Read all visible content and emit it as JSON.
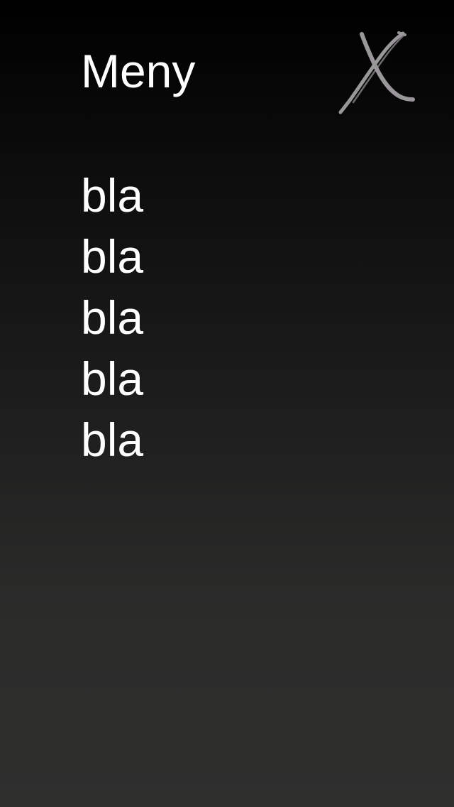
{
  "menu": {
    "title": "Meny",
    "close_icon": "close-x-icon",
    "close_icon_color": "#9a979a",
    "items": [
      {
        "label": "bla"
      },
      {
        "label": "bla"
      },
      {
        "label": "bla"
      },
      {
        "label": "bla"
      },
      {
        "label": "bla"
      }
    ]
  },
  "colors": {
    "background_top": "#000000",
    "background_bottom": "#2f2f2e",
    "text": "#ffffff"
  }
}
